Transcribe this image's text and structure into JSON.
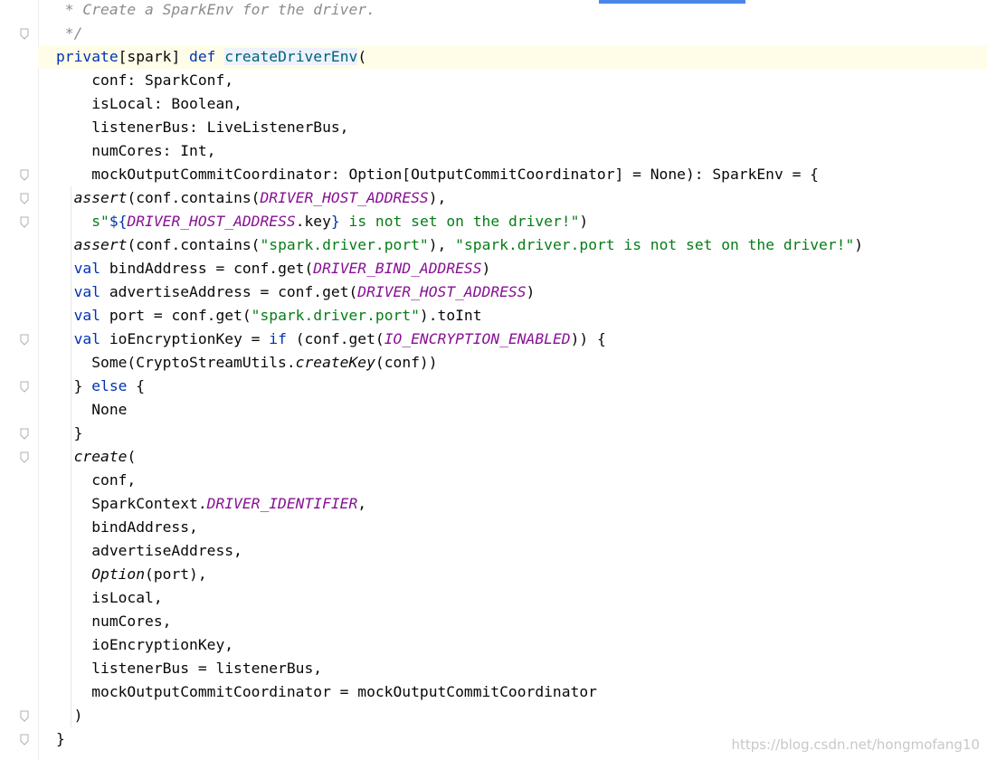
{
  "editor": {
    "language": "scala",
    "lines": [
      [
        {
          "t": " * Create a SparkEnv for the driver.",
          "c": "comment"
        }
      ],
      [
        {
          "t": " */",
          "c": "comment"
        }
      ],
      [
        {
          "t": "private",
          "c": "kw"
        },
        {
          "t": "[spark] ",
          "c": ""
        },
        {
          "t": "def",
          "c": "kw"
        },
        {
          "t": " ",
          "c": ""
        },
        {
          "t": "createDriverEnv",
          "c": "fn sel"
        },
        {
          "t": "(",
          "c": ""
        }
      ],
      [
        {
          "t": "    conf: SparkConf,",
          "c": ""
        }
      ],
      [
        {
          "t": "    isLocal: Boolean,",
          "c": ""
        }
      ],
      [
        {
          "t": "    listenerBus: LiveListenerBus,",
          "c": ""
        }
      ],
      [
        {
          "t": "    numCores: Int,",
          "c": ""
        }
      ],
      [
        {
          "t": "    mockOutputCommitCoordinator: Option[OutputCommitCoordinator] = None): SparkEnv = {",
          "c": ""
        }
      ],
      [
        {
          "t": "  ",
          "c": ""
        },
        {
          "t": "assert",
          "c": "it"
        },
        {
          "t": "(conf.contains(",
          "c": ""
        },
        {
          "t": "DRIVER_HOST_ADDRESS",
          "c": "const"
        },
        {
          "t": "),",
          "c": ""
        }
      ],
      [
        {
          "t": "    s\"",
          "c": "str"
        },
        {
          "t": "${",
          "c": "interp"
        },
        {
          "t": "DRIVER_HOST_ADDRESS",
          "c": "const"
        },
        {
          "t": ".key",
          "c": ""
        },
        {
          "t": "}",
          "c": "interp"
        },
        {
          "t": " is not set on the driver!\"",
          "c": "str"
        },
        {
          "t": ")",
          "c": ""
        }
      ],
      [
        {
          "t": "  ",
          "c": ""
        },
        {
          "t": "assert",
          "c": "it"
        },
        {
          "t": "(conf.contains(",
          "c": ""
        },
        {
          "t": "\"spark.driver.port\"",
          "c": "str"
        },
        {
          "t": "), ",
          "c": ""
        },
        {
          "t": "\"spark.driver.port is not set on the driver!\"",
          "c": "str"
        },
        {
          "t": ")",
          "c": ""
        }
      ],
      [
        {
          "t": "  ",
          "c": ""
        },
        {
          "t": "val",
          "c": "kw"
        },
        {
          "t": " bindAddress = conf.get(",
          "c": ""
        },
        {
          "t": "DRIVER_BIND_ADDRESS",
          "c": "const"
        },
        {
          "t": ")",
          "c": ""
        }
      ],
      [
        {
          "t": "  ",
          "c": ""
        },
        {
          "t": "val",
          "c": "kw"
        },
        {
          "t": " advertiseAddress = conf.get(",
          "c": ""
        },
        {
          "t": "DRIVER_HOST_ADDRESS",
          "c": "const"
        },
        {
          "t": ")",
          "c": ""
        }
      ],
      [
        {
          "t": "  ",
          "c": ""
        },
        {
          "t": "val",
          "c": "kw"
        },
        {
          "t": " port = conf.get(",
          "c": ""
        },
        {
          "t": "\"spark.driver.port\"",
          "c": "str"
        },
        {
          "t": ").toInt",
          "c": ""
        }
      ],
      [
        {
          "t": "  ",
          "c": ""
        },
        {
          "t": "val",
          "c": "kw"
        },
        {
          "t": " ioEncryptionKey = ",
          "c": ""
        },
        {
          "t": "if",
          "c": "kw"
        },
        {
          "t": " (conf.get(",
          "c": ""
        },
        {
          "t": "IO_ENCRYPTION_ENABLED",
          "c": "const"
        },
        {
          "t": ")) {",
          "c": ""
        }
      ],
      [
        {
          "t": "    Some(CryptoStreamUtils.",
          "c": ""
        },
        {
          "t": "createKey",
          "c": "it"
        },
        {
          "t": "(conf))",
          "c": ""
        }
      ],
      [
        {
          "t": "  } ",
          "c": ""
        },
        {
          "t": "else",
          "c": "kw"
        },
        {
          "t": " {",
          "c": ""
        }
      ],
      [
        {
          "t": "    None",
          "c": ""
        }
      ],
      [
        {
          "t": "  }",
          "c": ""
        }
      ],
      [
        {
          "t": "  ",
          "c": ""
        },
        {
          "t": "create",
          "c": "it"
        },
        {
          "t": "(",
          "c": ""
        }
      ],
      [
        {
          "t": "    conf,",
          "c": ""
        }
      ],
      [
        {
          "t": "    SparkContext.",
          "c": ""
        },
        {
          "t": "DRIVER_IDENTIFIER",
          "c": "const"
        },
        {
          "t": ",",
          "c": ""
        }
      ],
      [
        {
          "t": "    bindAddress,",
          "c": ""
        }
      ],
      [
        {
          "t": "    advertiseAddress,",
          "c": ""
        }
      ],
      [
        {
          "t": "    ",
          "c": ""
        },
        {
          "t": "Option",
          "c": "it"
        },
        {
          "t": "(port),",
          "c": ""
        }
      ],
      [
        {
          "t": "    isLocal,",
          "c": ""
        }
      ],
      [
        {
          "t": "    numCores,",
          "c": ""
        }
      ],
      [
        {
          "t": "    ioEncryptionKey,",
          "c": ""
        }
      ],
      [
        {
          "t": "    listenerBus = listenerBus,",
          "c": ""
        }
      ],
      [
        {
          "t": "    mockOutputCommitCoordinator = mockOutputCommitCoordinator",
          "c": ""
        }
      ],
      [
        {
          "t": "  )",
          "c": ""
        }
      ],
      [
        {
          "t": "}",
          "c": ""
        }
      ]
    ]
  },
  "watermark": "https://blog.csdn.net/hongmofang10"
}
